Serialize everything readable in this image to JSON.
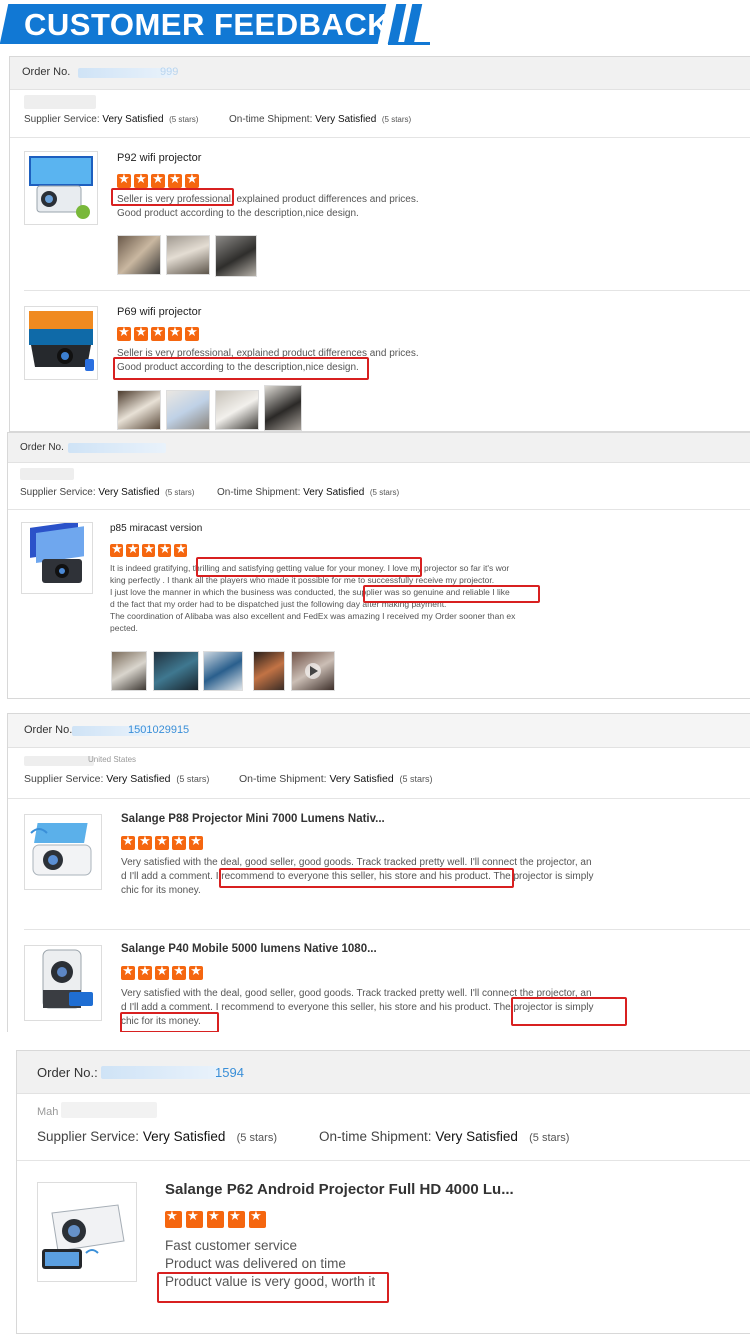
{
  "banner": {
    "title": "CUSTOMER FEEDBACK"
  },
  "colors": {
    "accent": "#1178d4",
    "star": "#f5660f",
    "highlight": "#d82020",
    "link": "#3a8fd8"
  },
  "common": {
    "order_label": "Order No.",
    "supplier_label": "Supplier Service:",
    "shipment_label": "On-time Shipment:",
    "very_satisfied": "Very Satisfied",
    "five_stars": "(5 stars)"
  },
  "panel1": {
    "order_suffix": "999",
    "reviews": [
      {
        "product": "P92 wifi projector",
        "rating": 5,
        "lines": [
          "Seller is very professional, explained product differences and prices.",
          "Good product according to the description,nice design."
        ]
      },
      {
        "product": "P69 wifi projector",
        "rating": 5,
        "lines": [
          "Seller is very professional, explained product differences and prices.",
          "Good product according to the description,nice design."
        ]
      }
    ]
  },
  "panel2": {
    "reviews": [
      {
        "product": "p85 miracast version",
        "rating": 5,
        "lines": [
          "It is indeed gratifying, thrilling and satisfying getting value for your money. I love my projector so far it's wor",
          "king perfectly . I thank all the players who made it possible for me to successfully receive my projector.",
          "I just love the manner in which the business was conducted, the supplier was so genuine and reliable I like",
          "d the fact that my order had to be dispatched just the following day after making payment.",
          "The coordination of Alibaba was also excellent and FedEx was amazing I received my Order sooner than ex",
          "pected."
        ]
      }
    ]
  },
  "panel3": {
    "order_suffix": "1501029915",
    "buyer_location": "United States",
    "reviews": [
      {
        "product": "Salange P88 Projector Mini 7000 Lumens Nativ...",
        "rating": 5,
        "lines": [
          "Very satisfied with the deal, good seller, good goods. Track tracked pretty well. I'll connect the projector, an",
          "d I'll add a comment. I recommend to everyone this seller, his store and his product. The projector is simply",
          "chic for its money."
        ]
      },
      {
        "product": "Salange P40 Mobile 5000 lumens Native 1080...",
        "rating": 5,
        "lines": [
          "Very satisfied with the deal, good seller, good goods. Track tracked pretty well. I'll connect the projector, an",
          "d I'll add a comment. I recommend to everyone this seller, his store and his product. The projector is simply",
          "chic for its money."
        ]
      }
    ]
  },
  "panel4": {
    "order_label": "Order No.:",
    "order_suffix": "1594",
    "buyer_prefix": "Mah",
    "reviews": [
      {
        "product": "Salange P62 Android Projector Full HD 4000 Lu...",
        "rating": 5,
        "lines": [
          "Fast customer service",
          "Product was delivered on time",
          "Product value is very good, worth it"
        ]
      }
    ]
  }
}
